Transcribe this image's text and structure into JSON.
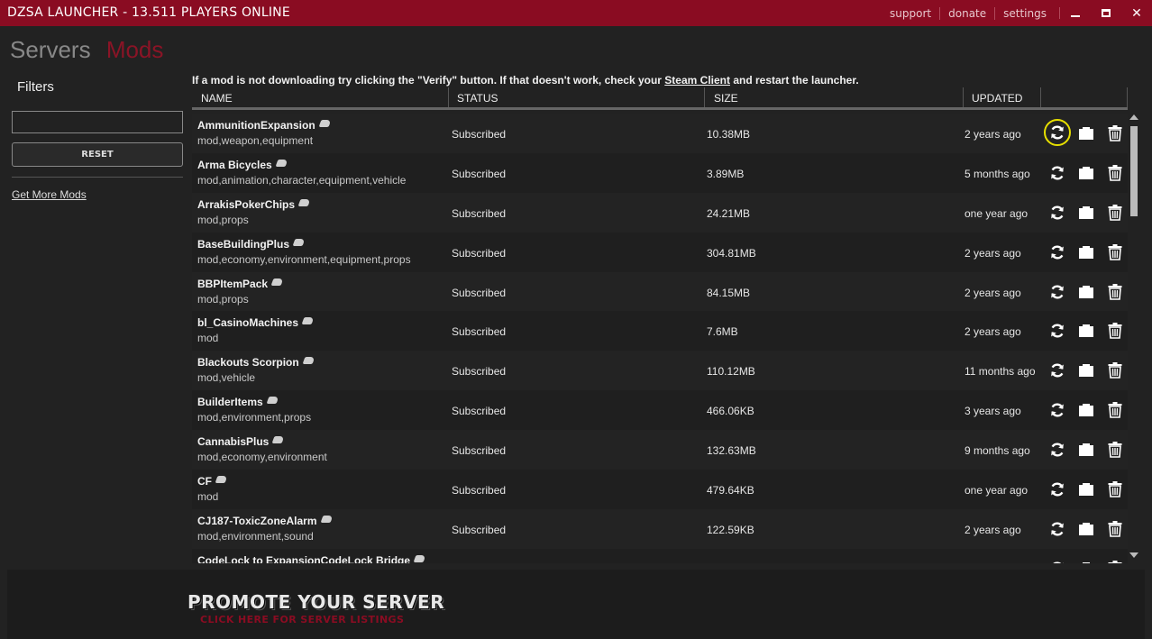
{
  "window": {
    "title": "DZSA LAUNCHER - 13.511 PLAYERS ONLINE",
    "links": [
      "support",
      "donate",
      "settings"
    ],
    "minimize_icon": "minimize-icon",
    "maximize_icon": "maximize-icon",
    "close_glyph": "✕"
  },
  "tabs": {
    "servers": "Servers",
    "mods": "Mods"
  },
  "sidebar": {
    "filters_title": "Filters",
    "filter_value": "",
    "reset_label": "RESET",
    "get_more_label": "Get More Mods"
  },
  "notice": {
    "text_before": "If a mod is not downloading try clicking the \"Verify\" button. If that doesn't work, check your ",
    "link": "Steam Client",
    "text_after": " and restart the launcher."
  },
  "table": {
    "headers": {
      "name": "NAME",
      "status": "STATUS",
      "size": "SIZE",
      "updated": "UPDATED"
    },
    "rows": [
      {
        "name": "AmmunitionExpansion",
        "tags": "mod,weapon,equipment",
        "status": "Subscribed",
        "size": "10.38MB",
        "updated": "2 years ago"
      },
      {
        "name": "Arma Bicycles",
        "tags": "mod,animation,character,equipment,vehicle",
        "status": "Subscribed",
        "size": "3.89MB",
        "updated": "5 months ago"
      },
      {
        "name": "ArrakisPokerChips",
        "tags": "mod,props",
        "status": "Subscribed",
        "size": "24.21MB",
        "updated": "one year ago"
      },
      {
        "name": "BaseBuildingPlus",
        "tags": "mod,economy,environment,equipment,props",
        "status": "Subscribed",
        "size": "304.81MB",
        "updated": "2 years ago"
      },
      {
        "name": "BBPItemPack",
        "tags": "mod,props",
        "status": "Subscribed",
        "size": "84.15MB",
        "updated": "2 years ago"
      },
      {
        "name": "bl_CasinoMachines",
        "tags": "mod",
        "status": "Subscribed",
        "size": "7.6MB",
        "updated": "2 years ago"
      },
      {
        "name": "Blackouts Scorpion",
        "tags": "mod,vehicle",
        "status": "Subscribed",
        "size": "110.12MB",
        "updated": "11 months ago"
      },
      {
        "name": "BuilderItems",
        "tags": "mod,environment,props",
        "status": "Subscribed",
        "size": "466.06KB",
        "updated": "3 years ago"
      },
      {
        "name": "CannabisPlus",
        "tags": "mod,economy,environment",
        "status": "Subscribed",
        "size": "132.63MB",
        "updated": "9 months ago"
      },
      {
        "name": "CF",
        "tags": "mod",
        "status": "Subscribed",
        "size": "479.64KB",
        "updated": "one year ago"
      },
      {
        "name": "CJ187-ToxicZoneAlarm",
        "tags": "mod,environment,sound",
        "status": "Subscribed",
        "size": "122.59KB",
        "updated": "2 years ago"
      },
      {
        "name": "CodeLock to ExpansionCodeLock Bridge",
        "tags": "",
        "status": "",
        "size": "",
        "updated": ""
      }
    ]
  },
  "banner": {
    "title": "PROMOTE YOUR SERVER",
    "subtitle": "CLICK HERE FOR SERVER LISTINGS"
  },
  "colors": {
    "accent": "#8a0c22",
    "highlight": "#e8e000"
  },
  "icons": {
    "verify": "refresh-icon",
    "folder": "folder-icon",
    "delete": "trash-icon",
    "steam": "steam-icon"
  }
}
